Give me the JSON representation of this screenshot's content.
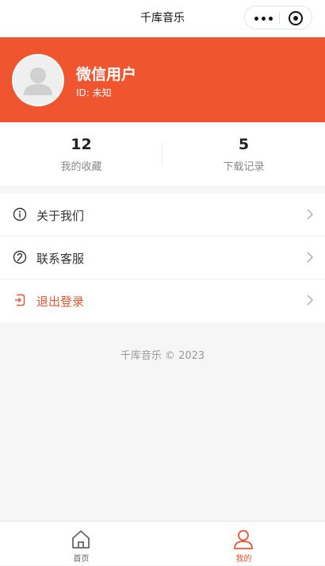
{
  "navbar": {
    "title": "千库音乐"
  },
  "profile": {
    "name": "微信用户",
    "id_text": "ID: 未知"
  },
  "stats": [
    {
      "value": "12",
      "label": "我的收藏"
    },
    {
      "value": "5",
      "label": "下载记录"
    }
  ],
  "menu": [
    {
      "label": "关于我们",
      "icon": "info-icon"
    },
    {
      "label": "联系客服",
      "icon": "customer-service-icon"
    },
    {
      "label": "退出登录",
      "icon": "logout-icon"
    }
  ],
  "footer": {
    "text": "千库音乐 © 2023"
  },
  "tabbar": [
    {
      "label": "首页",
      "icon": "home-icon"
    },
    {
      "label": "我的",
      "icon": "user-icon",
      "active": true
    }
  ],
  "colors": {
    "accent": "#ef5630",
    "active_tab": "#e8542e"
  }
}
